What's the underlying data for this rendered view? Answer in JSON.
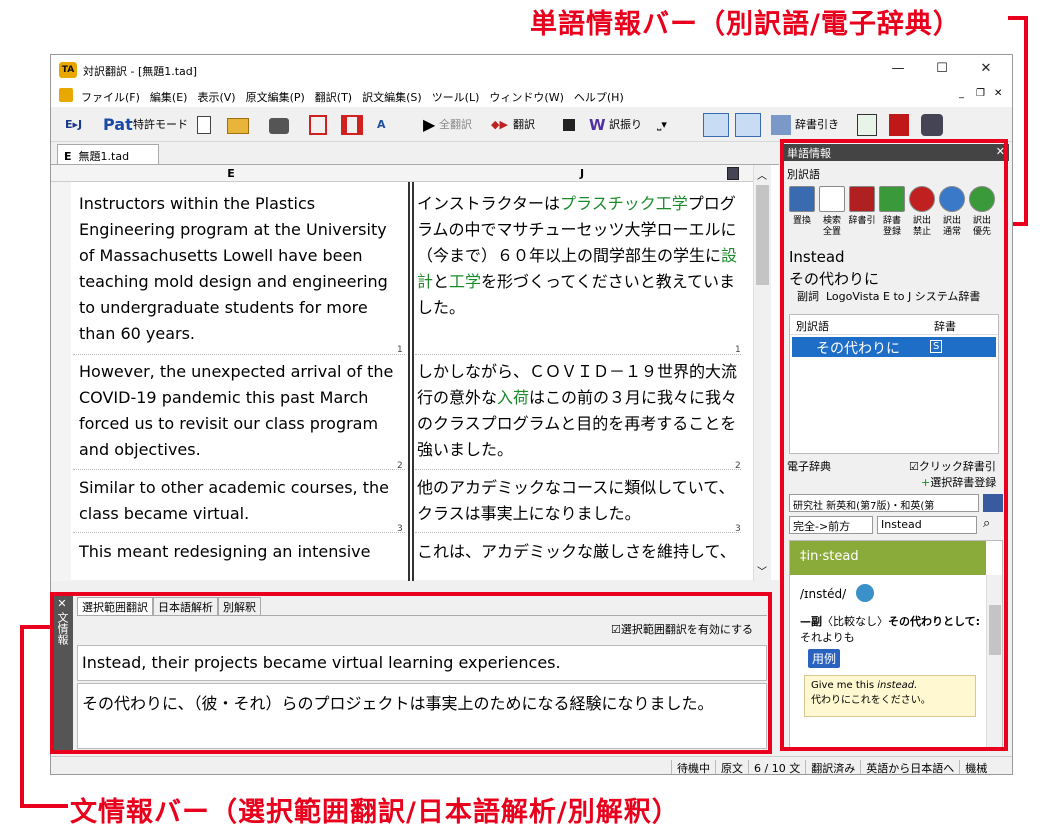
{
  "callouts": {
    "top": "単語情報バー（別訳語/電子辞典）",
    "bottom": "文情報バー（選択範囲翻訳/日本語解析/別解釈）"
  },
  "window": {
    "app_icon": "TA",
    "title": "対訳翻訳 - [無題1.tad]",
    "min": "—",
    "max": "☐",
    "close": "✕",
    "mdi_min": "_",
    "mdi_restore": "❐",
    "mdi_close": "✕"
  },
  "menu": [
    "ファイル(F)",
    "編集(E)",
    "表示(V)",
    "原文編集(P)",
    "翻訳(T)",
    "訳文編集(S)",
    "ツール(L)",
    "ウィンドウ(W)",
    "ヘルプ(H)"
  ],
  "toolbar": {
    "ej": "E▸J",
    "pat": "Pat",
    "patent_mode": "特許モード",
    "all_translate": "全翻訳",
    "translate": "翻訳",
    "furigana": "訳振り",
    "dict_lookup": "辞書引き"
  },
  "doc_tab": {
    "prefix": "E",
    "label": "無題1.tad"
  },
  "grid": {
    "col_e": "E",
    "col_j": "J",
    "rows": [
      {
        "num": "1",
        "en": "Instructors within the Plastics Engineering program at the University of Massachusetts Lowell have been teaching mold design and engineering to undergraduate students for more than 60 years.",
        "ja": [
          "インストラクターは",
          "プラスチック工学",
          "プログラムの中でマサチューセッツ大学ローエルに（今まで）６０年以上の間学部生の学生に",
          "設計",
          "と",
          "工学",
          "を形づくってくださいと教えていました。"
        ]
      },
      {
        "num": "2",
        "en": "However, the unexpected arrival of the COVID-19 pandemic this past March forced us to revisit our class program and objectives.",
        "ja": [
          "しかしながら、ＣＯＶＩＤ－１９世界的大流行の意外な",
          "入荷",
          "はこの前の３月に我々に我々のクラスプログラムと目的を再考することを強いました。"
        ]
      },
      {
        "num": "3",
        "en": "Similar to other academic courses, the class became virtual.",
        "ja": [
          "他のアカデミックなコースに類似していて、クラスは事実上になりました。"
        ]
      },
      {
        "num": "",
        "en": "This meant redesigning an intensive",
        "ja": [
          "これは、アカデミックな厳しさを維持して、"
        ]
      }
    ]
  },
  "bottom": {
    "close": "✕",
    "side_label": "文情報",
    "tabs": [
      "選択範囲翻訳",
      "日本語解析",
      "別解釈"
    ],
    "checkbox": "選択範囲翻訳を有効にする",
    "source": "Instead, their projects became virtual learning experiences.",
    "target": "その代わりに、（彼・それ）らのプロジェクトは事実上のためになる経験になりました。"
  },
  "status": [
    "待機中",
    "原文",
    "6 / 10 文",
    "翻訳済み",
    "英語から日本語へ",
    "機械"
  ],
  "right": {
    "header": "単語情報",
    "close": "✕",
    "section1": "別訳語",
    "buttons": [
      "置換",
      "検索\n全置",
      "辞書引",
      "辞書\n登録",
      "訳出\n禁止",
      "訳出\n通常",
      "訳出\n優先"
    ],
    "word": "Instead",
    "translation": "その代わりに",
    "pos": "副詞",
    "dict": "LogoVista E to J システム辞書",
    "list_head": [
      "別訳語",
      "辞書"
    ],
    "list_item": "その代わりに",
    "list_dict": "S",
    "section2": "電子辞典",
    "click_lookup": "クリック辞書引",
    "select_dict": "選択辞書登録",
    "dict_select": "研究社 新英和(第7版)・和英(第",
    "match_mode": "完全->前方",
    "query": "Instead",
    "entry_word": "‡in·stead",
    "pron": "/ɪnstéd/",
    "def_marker": "—副",
    "def": "〈比較なし〉",
    "def_bold": "その代わりとして:",
    "def2": "それよりも",
    "example_label": "用例",
    "example_en": "Give me this ",
    "example_en_it": "instead.",
    "example_ja": "代わりにこれをください。"
  }
}
